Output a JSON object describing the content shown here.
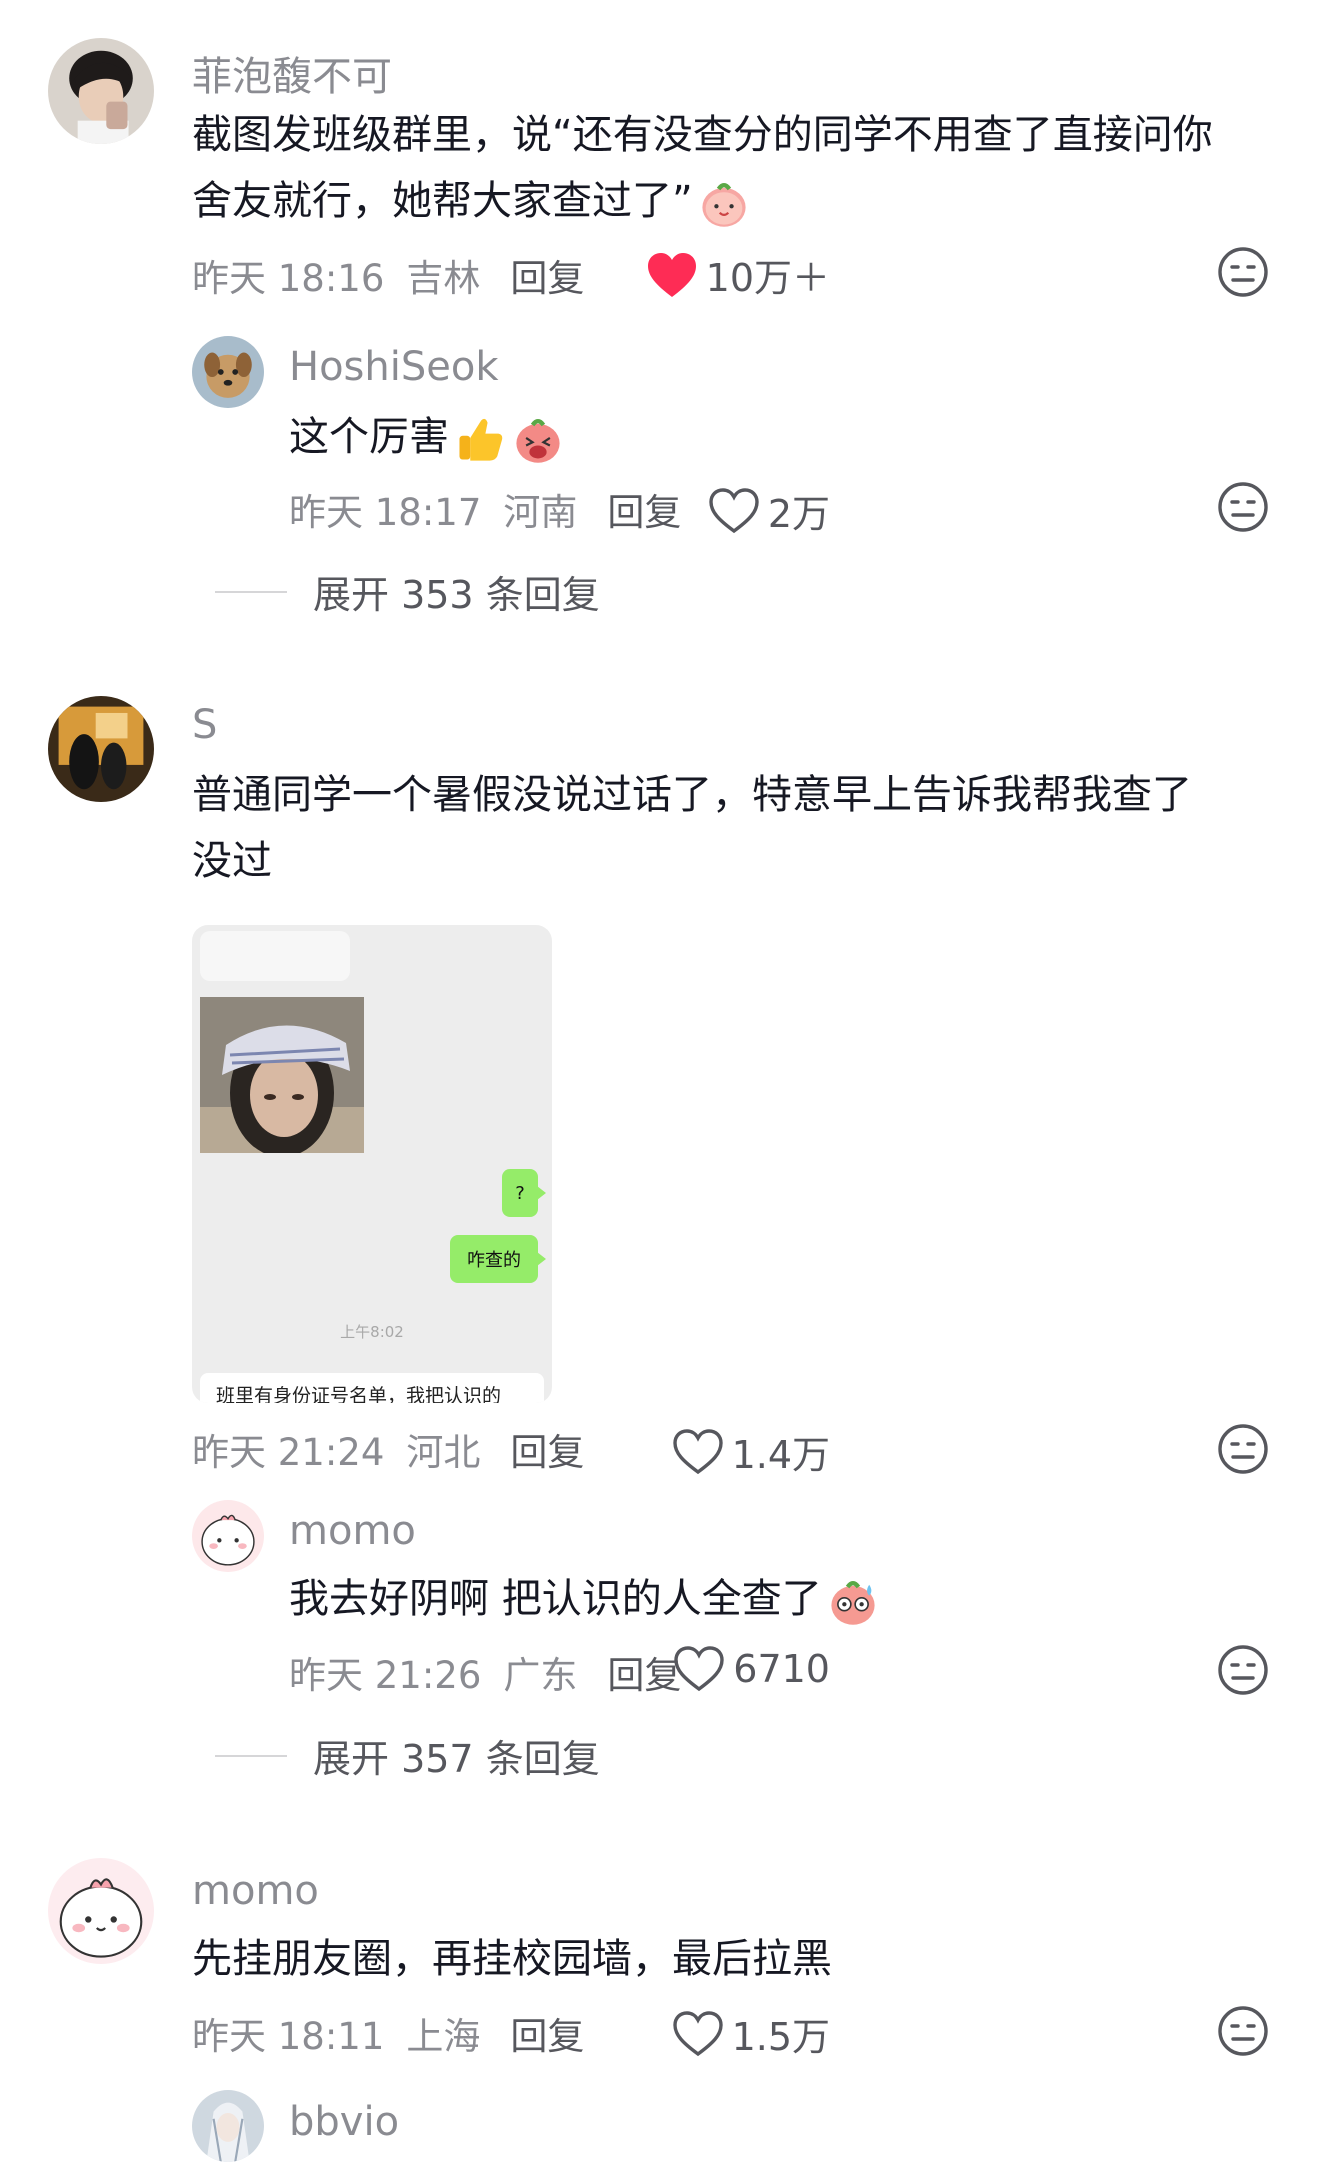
{
  "comments": [
    {
      "user": "菲泡馥不可",
      "text_line1": "截图发班级群里，说“还有没查分的同学不用查了直接问你",
      "text_line2": "舍友就行，她帮大家查过了”",
      "time": "昨天 18:16",
      "location": "吉林",
      "reply_label": "回复",
      "likes": "10万＋",
      "liked": true,
      "replies": [
        {
          "user": "HoshiSeok",
          "text": "这个厉害",
          "time": "昨天 18:17",
          "location": "河南",
          "reply_label": "回复",
          "likes": "2万"
        }
      ],
      "expand_label": "展开 353 条回复"
    },
    {
      "user": "S",
      "text_line1": "普通同学一个暑假没说过话了，特意早上告诉我帮我查了",
      "text_line2": "没过",
      "attachment": {
        "bubble1": "?",
        "bubble2": "咋查的",
        "time": "上午8:02",
        "last_message": "班里有身份证号名单，我把认识的"
      },
      "time": "昨天 21:24",
      "location": "河北",
      "reply_label": "回复",
      "likes": "1.4万",
      "replies": [
        {
          "user": "momo",
          "text": "我去好阴啊 把认识的人全查了",
          "time": "昨天 21:26",
          "location": "广东",
          "reply_label": "回复",
          "likes": "6710"
        }
      ],
      "expand_label": "展开 357 条回复"
    },
    {
      "user": "momo",
      "text_line1": "先挂朋友圈，再挂校园墙，最后拉黑",
      "time": "昨天 18:11",
      "location": "上海",
      "reply_label": "回复",
      "likes": "1.5万",
      "replies": [
        {
          "user": "bbvio"
        }
      ]
    }
  ],
  "colors": {
    "text": "#161823",
    "secondary": "#8a8b91",
    "like_active": "#fe2c55",
    "chat_bubble": "#95ec69"
  },
  "icons": [
    "heart-icon",
    "heart-filled-icon",
    "dislike-face-icon",
    "thumbs-up-emoji",
    "peach-emoji"
  ]
}
